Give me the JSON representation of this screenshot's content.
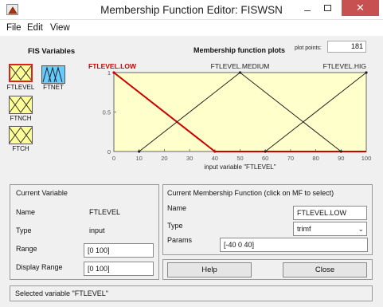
{
  "window": {
    "title": "Membership Function Editor: FISWSN",
    "close_glyph": "✕"
  },
  "menu": [
    "File",
    "Edit",
    "View"
  ],
  "fis_variables": {
    "title": "FIS Variables",
    "items": [
      {
        "label": "FTLEVEL",
        "selected": true,
        "color": "#ffff99",
        "type": "input"
      },
      {
        "label": "FTNET",
        "selected": false,
        "color": "#66ccff",
        "type": "output"
      },
      {
        "label": "FTNCH",
        "selected": false,
        "color": "#ffff99",
        "type": "input"
      },
      {
        "label": "FTCH",
        "selected": false,
        "color": "#ffff99",
        "type": "input"
      }
    ]
  },
  "plot": {
    "title": "Membership function plots",
    "plot_points_label": "plot points:",
    "plot_points_value": "181",
    "background": "#ffffcc",
    "selected_color": "#cc0000",
    "mf_labels": [
      "FTLEVEL.LOW",
      "FTLEVEL.MEDIUM",
      "FTLEVEL.HIG"
    ]
  },
  "chart_data": {
    "type": "line",
    "xlabel": "input variable \"FTLEVEL\"",
    "xlim": [
      0,
      100
    ],
    "ylim": [
      0,
      1
    ],
    "x_ticks": [
      "0",
      "10",
      "20",
      "30",
      "40",
      "50",
      "60",
      "70",
      "80",
      "90",
      "100"
    ],
    "y_ticks": [
      "0",
      "0.5",
      "1"
    ],
    "series": [
      {
        "name": "FTLEVEL.LOW",
        "x": [
          0,
          40
        ],
        "y": [
          1,
          0
        ],
        "selected": true
      },
      {
        "name": "FTLEVEL.MEDIUM",
        "x": [
          10,
          50,
          90
        ],
        "y": [
          0,
          1,
          0
        ],
        "selected": false
      },
      {
        "name": "FTLEVEL.HIG",
        "x": [
          60,
          100
        ],
        "y": [
          0,
          1
        ],
        "selected": false
      }
    ]
  },
  "current_variable": {
    "header": "Current Variable",
    "name_label": "Name",
    "name_value": "FTLEVEL",
    "type_label": "Type",
    "type_value": "input",
    "range_label": "Range",
    "range_value": "[0 100]",
    "display_range_label": "Display Range",
    "display_range_value": "[0 100]"
  },
  "current_mf": {
    "header": "Current Membership Function (click on MF to select)",
    "name_label": "Name",
    "name_value": "FTLEVEL.LOW",
    "type_label": "Type",
    "type_value": "trimf",
    "params_label": "Params",
    "params_value": "[-40 0 40]"
  },
  "buttons": {
    "help": "Help",
    "close": "Close"
  },
  "status": "Selected variable \"FTLEVEL\""
}
